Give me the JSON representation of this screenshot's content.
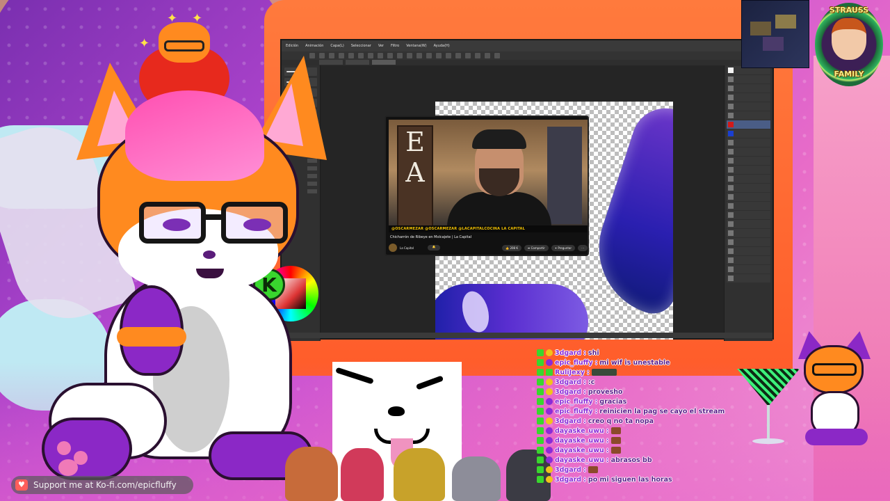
{
  "app": {
    "menu": [
      "Edición",
      "Animación",
      "Capa(L)",
      "Seleccionar",
      "Ver",
      "Filtro",
      "Ventana(W)",
      "Ayuda(H)"
    ]
  },
  "video": {
    "sign_letters": [
      "E",
      "A"
    ],
    "ticker": "@OSCARMEZAR  @OSCARMEZAR  @LACAPITALCOCINA  LA CAPITAL",
    "title": "Chicharrón de Ribeye en Molcajete | La Capital",
    "channel": "La Capital",
    "likes": "208 K",
    "share": "Compartir",
    "ask": "Preguntar"
  },
  "color_widget": {
    "letter": "K"
  },
  "badge": {
    "top_text": "STRAUSS",
    "bottom_text": "FAMILY"
  },
  "chat": [
    {
      "user": "3dgard",
      "msg": "shi",
      "emote": false,
      "badge": "y"
    },
    {
      "user": "epic_fluffy",
      "msg": "mi wif is unestable",
      "emote": false,
      "badge": "p"
    },
    {
      "user": "RuliJexy",
      "msg": "",
      "emote": true,
      "wide": true,
      "badge": "k"
    },
    {
      "user": "3dgard",
      "msg": ":c",
      "emote": false,
      "badge": "y"
    },
    {
      "user": "3dgard",
      "msg": "provesho",
      "emote": false,
      "badge": "y"
    },
    {
      "user": "epic_fluffy",
      "msg": "gracias",
      "emote": false,
      "badge": "p"
    },
    {
      "user": "epic_fluffy",
      "msg": "reinicien la pag se cayo el stream",
      "emote": false,
      "badge": "p"
    },
    {
      "user": "3dgard",
      "msg": "creo q no ta nopa",
      "emote": false,
      "badge": "y"
    },
    {
      "user": "dayaske_uwu",
      "msg": "",
      "emote": true,
      "wide": false,
      "badge": "p"
    },
    {
      "user": "dayaske_uwu",
      "msg": "",
      "emote": true,
      "wide": false,
      "badge": "p"
    },
    {
      "user": "dayaske_uwu",
      "msg": "",
      "emote": true,
      "wide": false,
      "badge": "p"
    },
    {
      "user": "dayaske_uwu",
      "msg": "abrasos bb",
      "emote": false,
      "badge": "p"
    },
    {
      "user": "3dgard",
      "msg": "",
      "emote": true,
      "wide": false,
      "badge": "y"
    },
    {
      "user": "3dgard",
      "msg": "po mi siguen las horas",
      "emote": false,
      "badge": "y"
    }
  ],
  "kofi": {
    "text": "Support me at Ko-fi.com/epicfluffy"
  },
  "colors": {
    "accent_orange": "#ff8a1f",
    "accent_purple": "#8b28c6",
    "chat_user": "#8a2bd8",
    "kofi_red": "#ff5e5b"
  }
}
